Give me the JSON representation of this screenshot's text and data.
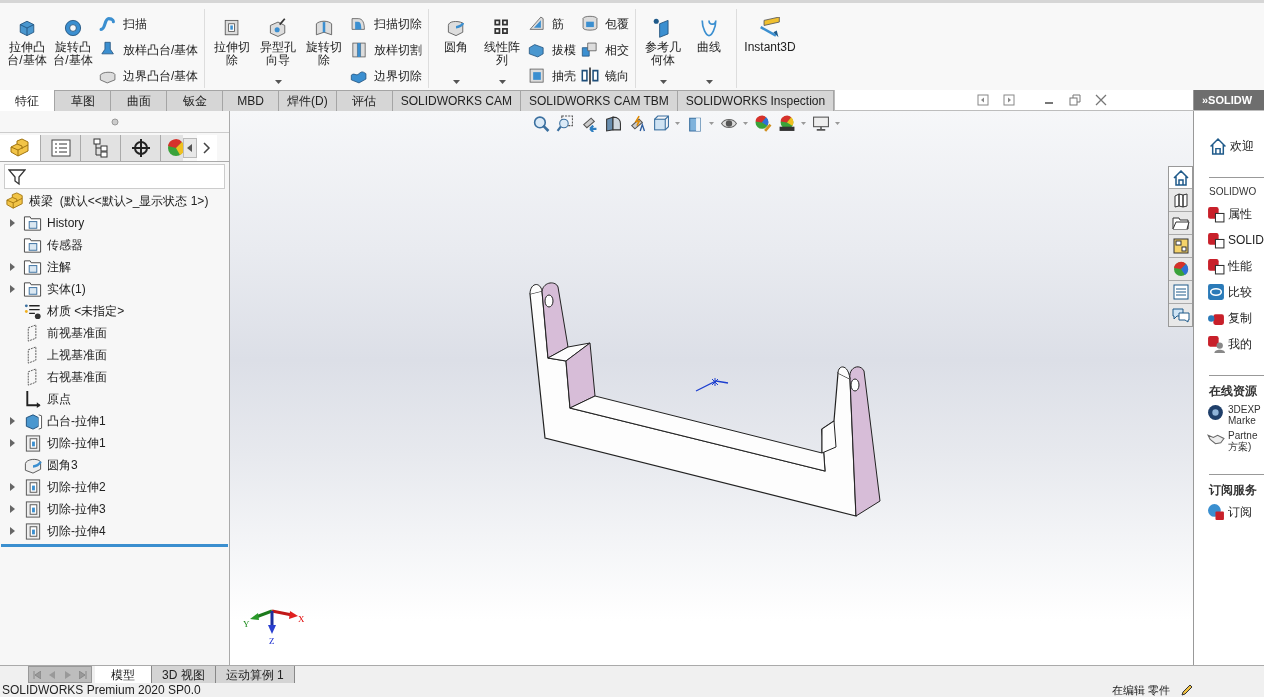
{
  "ribbon": {
    "groups": [
      {
        "items": [
          {
            "label": "拉伸凸台/基体",
            "kind": "large",
            "dropdown": false
          },
          {
            "label": "旋转凸台/基体",
            "kind": "large",
            "dropdown": false
          },
          {
            "label": "扫描",
            "kind": "small"
          },
          {
            "label": "放样凸台/基体",
            "kind": "small"
          },
          {
            "label": "边界凸台/基体",
            "kind": "small"
          }
        ]
      },
      {
        "items": [
          {
            "label": "拉伸切除",
            "kind": "large",
            "dropdown": false
          },
          {
            "label": "异型孔向导",
            "kind": "large",
            "dropdown": true
          },
          {
            "label": "旋转切除",
            "kind": "large",
            "dropdown": false
          },
          {
            "label": "扫描切除",
            "kind": "small"
          },
          {
            "label": "放样切割",
            "kind": "small"
          },
          {
            "label": "边界切除",
            "kind": "small"
          }
        ]
      },
      {
        "items": [
          {
            "label": "圆角",
            "kind": "large",
            "dropdown": true
          },
          {
            "label": "线性阵列",
            "kind": "large",
            "dropdown": true
          },
          {
            "label": "筋",
            "kind": "small"
          },
          {
            "label": "拔模",
            "kind": "small"
          },
          {
            "label": "抽壳",
            "kind": "small"
          },
          {
            "label": "包覆",
            "kind": "small"
          },
          {
            "label": "相交",
            "kind": "small"
          },
          {
            "label": "镜向",
            "kind": "small"
          }
        ]
      },
      {
        "items": [
          {
            "label": "参考几何体",
            "kind": "large",
            "dropdown": true
          },
          {
            "label": "曲线",
            "kind": "large",
            "dropdown": true
          }
        ]
      },
      {
        "items": [
          {
            "label": "Instant3D",
            "kind": "large",
            "dropdown": false
          }
        ]
      }
    ]
  },
  "tabs": [
    {
      "label": "特征",
      "selected": true
    },
    {
      "label": "草图",
      "selected": false
    },
    {
      "label": "曲面",
      "selected": false
    },
    {
      "label": "钣金",
      "selected": false
    },
    {
      "label": "MBD",
      "selected": false
    },
    {
      "label": "焊件(D)",
      "selected": false
    },
    {
      "label": "评估",
      "selected": false
    },
    {
      "label": "SOLIDWORKS CAM",
      "selected": false
    },
    {
      "label": "SOLIDWORKS CAM TBM",
      "selected": false
    },
    {
      "label": "SOLIDWORKS Inspection",
      "selected": false
    }
  ],
  "feature_tree": {
    "root": "横梁  (默认<<默认>_显示状态 1>)",
    "items": [
      {
        "label": "History",
        "kind": "folder",
        "expandable": true
      },
      {
        "label": "传感器",
        "kind": "folder",
        "expandable": false
      },
      {
        "label": "注解",
        "kind": "folder",
        "expandable": true
      },
      {
        "label": "实体(1)",
        "kind": "folder",
        "expandable": true
      },
      {
        "label": "材质 <未指定>",
        "kind": "material",
        "expandable": false
      },
      {
        "label": "前视基准面",
        "kind": "plane",
        "expandable": false
      },
      {
        "label": "上视基准面",
        "kind": "plane",
        "expandable": false
      },
      {
        "label": "右视基准面",
        "kind": "plane",
        "expandable": false
      },
      {
        "label": "原点",
        "kind": "origin",
        "expandable": false
      },
      {
        "label": "凸台-拉伸1",
        "kind": "boss",
        "expandable": true
      },
      {
        "label": "切除-拉伸1",
        "kind": "cut",
        "expandable": true
      },
      {
        "label": "圆角3",
        "kind": "fillet",
        "expandable": false
      },
      {
        "label": "切除-拉伸2",
        "kind": "cut",
        "expandable": true
      },
      {
        "label": "切除-拉伸3",
        "kind": "cut",
        "expandable": true
      },
      {
        "label": "切除-拉伸4",
        "kind": "cut",
        "expandable": true
      }
    ]
  },
  "triad": {
    "x": "X",
    "y": "Y",
    "z": "Z"
  },
  "task_pane": {
    "title": "»SOLIDW",
    "welcome": "欢迎",
    "sections": [
      {
        "title": "SOLIDWO",
        "bold": false,
        "items": [
          {
            "lines": [
              "属性"
            ]
          },
          {
            "lines": [
              "SOLID"
            ]
          },
          {
            "lines": [
              "性能"
            ]
          },
          {
            "lines": [
              "比较"
            ]
          },
          {
            "lines": [
              "复制"
            ]
          },
          {
            "lines": [
              "我的"
            ]
          }
        ]
      },
      {
        "title": "在线资源",
        "bold": true,
        "items": [
          {
            "lines": [
              "3DEXP",
              "Marke"
            ]
          },
          {
            "lines": [
              "Partne",
              "方案)"
            ]
          }
        ]
      },
      {
        "title": "订阅服务",
        "bold": true,
        "items": [
          {
            "lines": [
              "订阅"
            ]
          }
        ]
      }
    ]
  },
  "bottom_tabs": [
    {
      "label": "模型",
      "selected": true
    },
    {
      "label": "3D 视图",
      "selected": false
    },
    {
      "label": "运动算例 1",
      "selected": false
    }
  ],
  "status_bar": {
    "left": "SOLIDWORKS Premium 2020 SP0.0",
    "right": "在编辑 零件"
  }
}
